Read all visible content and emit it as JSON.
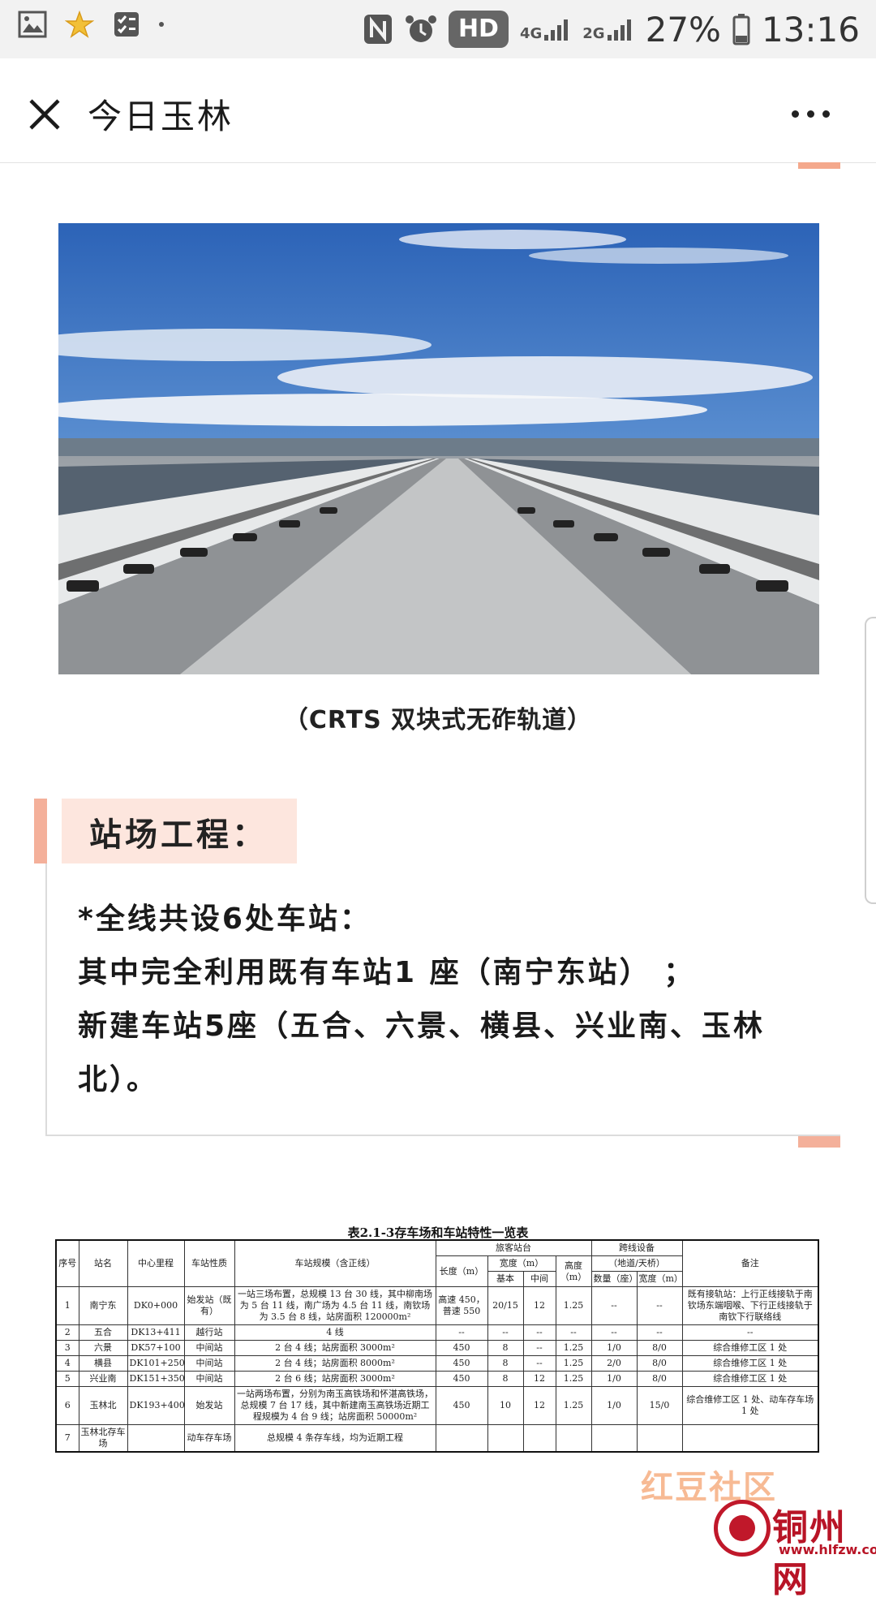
{
  "status_bar": {
    "network_top": "4G",
    "network_bottom": "2G",
    "battery": "27%",
    "time": "13:16",
    "hd": "HD",
    "icons": [
      "gallery-icon",
      "star-badge-icon",
      "checklist-icon",
      "nfc-icon",
      "alarm-icon",
      "signal-icon",
      "battery-icon"
    ]
  },
  "header": {
    "title": "今日玉林"
  },
  "article": {
    "caption": "（CRTS 双块式无砟轨道）",
    "section_title": "站场工程：",
    "lines": [
      "*全线共设6处车站：",
      "其中完全利用既有车站1 座（南宁东站）  ；",
      "新建车站5座（五合、六景、横县、兴业南、玉林北）。"
    ]
  },
  "table": {
    "title": "表2.1-3存车场和车站特性一览表",
    "headers": {
      "seq": "序号",
      "name": "站名",
      "mileage": "中心里程",
      "nature": "车站性质",
      "scale": "车站规模（含正线）",
      "platform": "旅客站台",
      "length": "长度（m）",
      "width": "宽度（m）",
      "basic": "基本",
      "middle": "中间",
      "height": "高度（m）",
      "crossing": "跨线设备",
      "crossing_sub": "（地道/天桥）",
      "count": "数量（座）",
      "cwidth": "宽度（m）",
      "remark": "备注"
    },
    "rows": [
      {
        "seq": "1",
        "name": "南宁东",
        "mileage": "DK0+000",
        "nature": "始发站（既有）",
        "scale": "一站三场布置，总规模 13 台 30 线，其中柳南场为 5 台 11 线，南广场为 4.5 台 11 线，南钦场为 3.5 台 8 线，站房面积 120000m²",
        "length": "高速 450，普速 550",
        "basic": "20/15",
        "middle": "12",
        "height": "1.25",
        "count": "--",
        "cwidth": "--",
        "remark": "既有接轨站：上行正线接轨于南钦场东端咽喉、下行正线接轨于南钦下行联络线"
      },
      {
        "seq": "2",
        "name": "五合",
        "mileage": "DK13+411",
        "nature": "越行站",
        "scale": "4 线",
        "length": "--",
        "basic": "--",
        "middle": "--",
        "height": "--",
        "count": "--",
        "cwidth": "--",
        "remark": "--"
      },
      {
        "seq": "3",
        "name": "六景",
        "mileage": "DK57+100",
        "nature": "中间站",
        "scale": "2 台 4 线；站房面积 3000m²",
        "length": "450",
        "basic": "8",
        "middle": "--",
        "height": "1.25",
        "count": "1/0",
        "cwidth": "8/0",
        "remark": "综合维修工区 1 处"
      },
      {
        "seq": "4",
        "name": "横县",
        "mileage": "DK101+250",
        "nature": "中间站",
        "scale": "2 台 4 线；站房面积 8000m²",
        "length": "450",
        "basic": "8",
        "middle": "--",
        "height": "1.25",
        "count": "2/0",
        "cwidth": "8/0",
        "remark": "综合维修工区 1 处"
      },
      {
        "seq": "5",
        "name": "兴业南",
        "mileage": "DK151+350",
        "nature": "中间站",
        "scale": "2 台 6 线；站房面积 3000m²",
        "length": "450",
        "basic": "8",
        "middle": "12",
        "height": "1.25",
        "count": "1/0",
        "cwidth": "8/0",
        "remark": "综合维修工区 1 处"
      },
      {
        "seq": "6",
        "name": "玉林北",
        "mileage": "DK193+400",
        "nature": "始发站",
        "scale": "一站两场布置，分别为南玉高铁场和怀湛高铁场，总规模 7 台 17 线，其中新建南玉高铁场近期工程规模为 4 台 9 线；站房面积 50000m²",
        "length": "450",
        "basic": "10",
        "middle": "12",
        "height": "1.25",
        "count": "1/0",
        "cwidth": "15/0",
        "remark": "综合维修工区 1 处、动车存车场 1 处"
      },
      {
        "seq": "7",
        "name": "玉林北存车场",
        "mileage": "",
        "nature": "动车存车场",
        "scale": "总规模 4 条存车线，均为近期工程",
        "length": "",
        "basic": "",
        "middle": "",
        "height": "",
        "count": "",
        "cwidth": "",
        "remark": ""
      }
    ]
  },
  "watermarks": {
    "hongdou": "红豆社区",
    "tongzhou": "铜州网",
    "url": "www.hlfzw.com"
  },
  "colors": {
    "accent": "#f4b09a",
    "accent_light": "#fde6de",
    "statusbar_bg": "#f2f2f2"
  }
}
